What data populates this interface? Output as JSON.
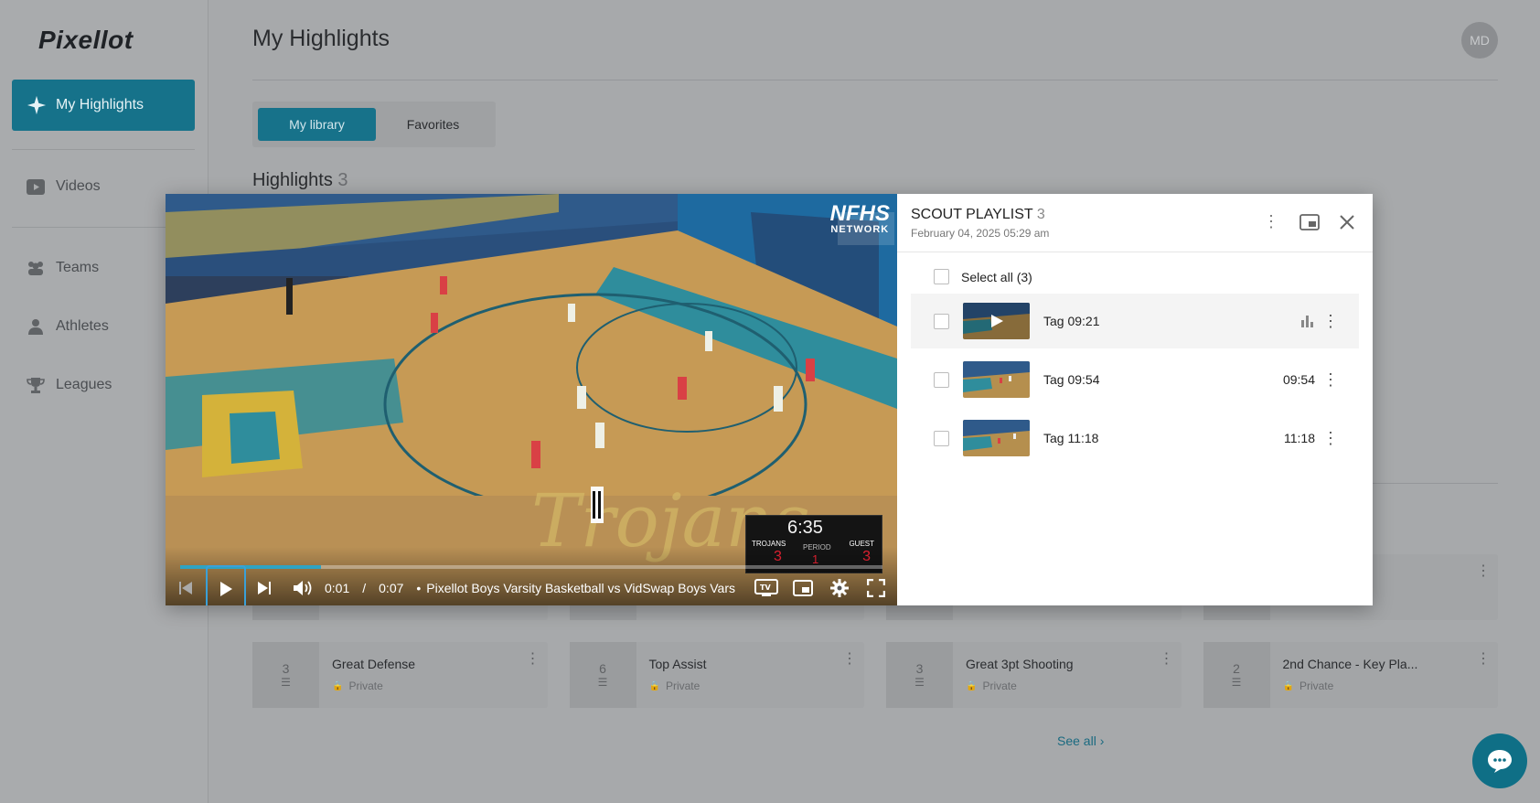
{
  "app": {
    "logo": "Pixellot"
  },
  "sidebar": {
    "active": "My Highlights",
    "items": [
      "Videos",
      "Teams",
      "Athletes",
      "Leagues"
    ]
  },
  "header": {
    "title": "My Highlights",
    "avatar": "MD"
  },
  "tabs": {
    "active": "My library",
    "other": "Favorites"
  },
  "highlights": {
    "label": "Highlights",
    "count": "3"
  },
  "playlists": [
    {
      "count": "3",
      "title": "Great Defense",
      "privacy": "Private"
    },
    {
      "count": "6",
      "title": "Top Assist",
      "privacy": "Private"
    },
    {
      "count": "3",
      "title": "Great 3pt Shooting",
      "privacy": "Private"
    },
    {
      "count": "2",
      "title": "2nd Chance - Key Pla...",
      "privacy": "Private"
    }
  ],
  "see_all": "See all",
  "player": {
    "time_current": "0:01",
    "time_sep": "/",
    "time_total": "0:07",
    "bullet": "•",
    "video_title": "Pixellot Boys Varsity Basketball vs VidSwap Boys Vars",
    "progress": 0.2,
    "watermark_top": "NFHS",
    "watermark_bottom": "NETWORK",
    "scoreboard": {
      "clock": "6:35",
      "home": "TROJANS",
      "guest": "GUEST",
      "home_score": "3",
      "guest_score": "3",
      "period_label": "PERIOD",
      "period": "1"
    }
  },
  "playlist_panel": {
    "title": "SCOUT PLAYLIST",
    "count": "3",
    "date": "February 04, 2025 05:29 am",
    "select_all": "Select all (3)",
    "clips": [
      {
        "label": "Tag 09:21",
        "duration": ""
      },
      {
        "label": "Tag 09:54",
        "duration": "09:54"
      },
      {
        "label": "Tag 11:18",
        "duration": "11:18"
      }
    ]
  },
  "colors": {
    "accent": "#16728a",
    "progress": "#2ea3c3"
  }
}
